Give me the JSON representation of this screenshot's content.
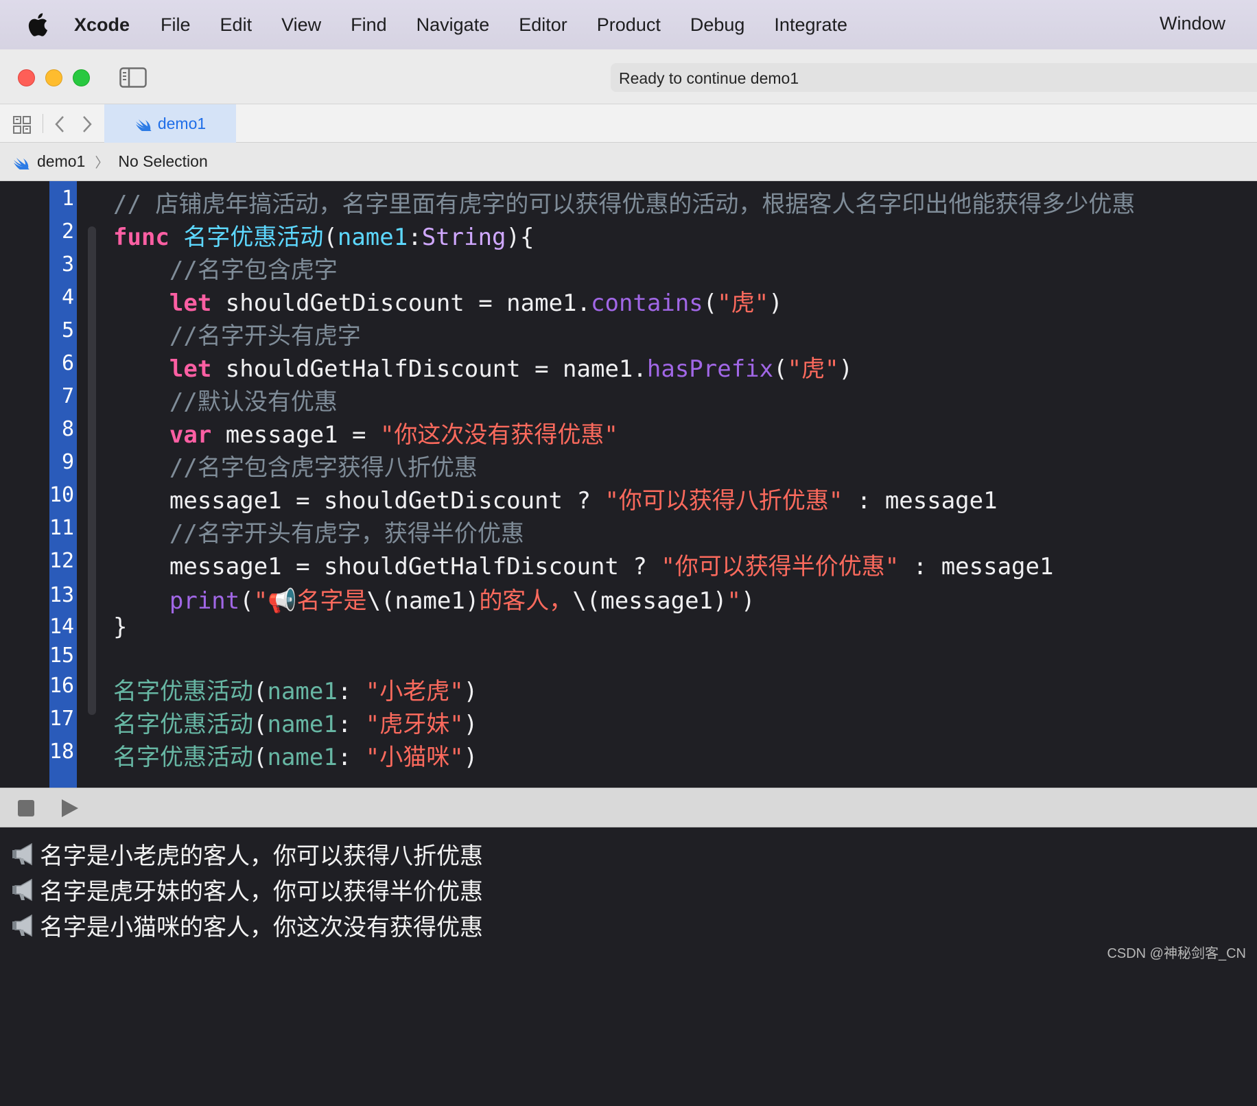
{
  "menubar": {
    "app_name": "Xcode",
    "items": [
      "File",
      "Edit",
      "View",
      "Find",
      "Navigate",
      "Editor",
      "Product",
      "Debug",
      "Integrate"
    ],
    "right_item": "Window"
  },
  "titlebar": {
    "status": "Ready to continue demo1"
  },
  "tabbar": {
    "active_tab": "demo1"
  },
  "jumpbar": {
    "project": "demo1",
    "selection": "No Selection"
  },
  "editor": {
    "line_numbers": [
      "1",
      "2",
      "3",
      "4",
      "5",
      "6",
      "7",
      "8",
      "9",
      "10",
      "11",
      "12",
      "13",
      "14",
      "15",
      "16",
      "17",
      "18"
    ],
    "lines": [
      [
        {
          "t": "comment",
          "v": "// 店铺虎年搞活动，名字里面有虎字的可以获得优惠的活动，根据客人名字印出他能获得多少优惠"
        }
      ],
      [
        {
          "t": "kw",
          "v": "func"
        },
        {
          "t": "plain",
          "v": " "
        },
        {
          "t": "param",
          "v": "名字优惠活动"
        },
        {
          "t": "plain",
          "v": "("
        },
        {
          "t": "param",
          "v": "name1"
        },
        {
          "t": "plain",
          "v": ":"
        },
        {
          "t": "type",
          "v": "String"
        },
        {
          "t": "plain",
          "v": "){"
        }
      ],
      [
        {
          "t": "plain",
          "v": "    "
        },
        {
          "t": "comment",
          "v": "//名字包含虎字"
        }
      ],
      [
        {
          "t": "plain",
          "v": "    "
        },
        {
          "t": "kw",
          "v": "let"
        },
        {
          "t": "plain",
          "v": " shouldGetDiscount = name1."
        },
        {
          "t": "method",
          "v": "contains"
        },
        {
          "t": "plain",
          "v": "("
        },
        {
          "t": "str",
          "v": "\"虎\""
        },
        {
          "t": "plain",
          "v": ")"
        }
      ],
      [
        {
          "t": "plain",
          "v": "    "
        },
        {
          "t": "comment",
          "v": "//名字开头有虎字"
        }
      ],
      [
        {
          "t": "plain",
          "v": "    "
        },
        {
          "t": "kw",
          "v": "let"
        },
        {
          "t": "plain",
          "v": " shouldGetHalfDiscount = name1."
        },
        {
          "t": "method",
          "v": "hasPrefix"
        },
        {
          "t": "plain",
          "v": "("
        },
        {
          "t": "str",
          "v": "\"虎\""
        },
        {
          "t": "plain",
          "v": ")"
        }
      ],
      [
        {
          "t": "plain",
          "v": "    "
        },
        {
          "t": "comment",
          "v": "//默认没有优惠"
        }
      ],
      [
        {
          "t": "plain",
          "v": "    "
        },
        {
          "t": "kw",
          "v": "var"
        },
        {
          "t": "plain",
          "v": " message1 = "
        },
        {
          "t": "str",
          "v": "\"你这次没有获得优惠\""
        }
      ],
      [
        {
          "t": "plain",
          "v": "    "
        },
        {
          "t": "comment",
          "v": "//名字包含虎字获得八折优惠"
        }
      ],
      [
        {
          "t": "plain",
          "v": "    message1 = shouldGetDiscount ? "
        },
        {
          "t": "str",
          "v": "\"你可以获得八折优惠\""
        },
        {
          "t": "plain",
          "v": " : message1"
        }
      ],
      [
        {
          "t": "plain",
          "v": "    "
        },
        {
          "t": "comment",
          "v": "//名字开头有虎字，获得半价优惠"
        }
      ],
      [
        {
          "t": "plain",
          "v": "    message1 = shouldGetHalfDiscount ? "
        },
        {
          "t": "str",
          "v": "\"你可以获得半价优惠\""
        },
        {
          "t": "plain",
          "v": " : message1"
        }
      ],
      [
        {
          "t": "plain",
          "v": "    "
        },
        {
          "t": "method",
          "v": "print"
        },
        {
          "t": "plain",
          "v": "("
        },
        {
          "t": "str",
          "v": "\"📢名字是"
        },
        {
          "t": "plain",
          "v": "\\(name1)"
        },
        {
          "t": "str",
          "v": "的客人，"
        },
        {
          "t": "plain",
          "v": "\\(message1)"
        },
        {
          "t": "str",
          "v": "\""
        },
        {
          "t": "plain",
          "v": ")"
        }
      ],
      [
        {
          "t": "plain",
          "v": "}"
        }
      ],
      [
        {
          "t": "plain",
          "v": ""
        }
      ],
      [
        {
          "t": "func",
          "v": "名字优惠活动"
        },
        {
          "t": "plain",
          "v": "("
        },
        {
          "t": "func",
          "v": "name1"
        },
        {
          "t": "plain",
          "v": ": "
        },
        {
          "t": "str",
          "v": "\"小老虎\""
        },
        {
          "t": "plain",
          "v": ")"
        }
      ],
      [
        {
          "t": "func",
          "v": "名字优惠活动"
        },
        {
          "t": "plain",
          "v": "("
        },
        {
          "t": "func",
          "v": "name1"
        },
        {
          "t": "plain",
          "v": ": "
        },
        {
          "t": "str",
          "v": "\"虎牙妹\""
        },
        {
          "t": "plain",
          "v": ")"
        }
      ],
      [
        {
          "t": "func",
          "v": "名字优惠活动"
        },
        {
          "t": "plain",
          "v": "("
        },
        {
          "t": "func",
          "v": "name1"
        },
        {
          "t": "plain",
          "v": ": "
        },
        {
          "t": "str",
          "v": "\"小猫咪\""
        },
        {
          "t": "plain",
          "v": ")"
        }
      ]
    ]
  },
  "console": {
    "lines": [
      "名字是小老虎的客人，你可以获得八折优惠",
      "名字是虎牙妹的客人，你可以获得半价优惠",
      "名字是小猫咪的客人，你这次没有获得优惠"
    ]
  },
  "watermark": "CSDN @神秘剑客_CN",
  "colors": {
    "keyword": "#fc5fa3",
    "string": "#fc6a5d",
    "comment": "#7f8c98",
    "function_call": "#67b7a4",
    "gutter": "#2a5bba",
    "accent": "#1f6ee8"
  },
  "icons": {
    "apple": "apple-logo-icon",
    "sidebar": "sidebar-toggle-icon",
    "grid": "related-items-grid-icon",
    "back": "chevron-left-icon",
    "forward": "chevron-right-icon",
    "swift": "swift-icon",
    "run": "play-circle-icon",
    "stop": "stop-icon",
    "play": "play-icon",
    "megaphone": "megaphone-icon"
  }
}
